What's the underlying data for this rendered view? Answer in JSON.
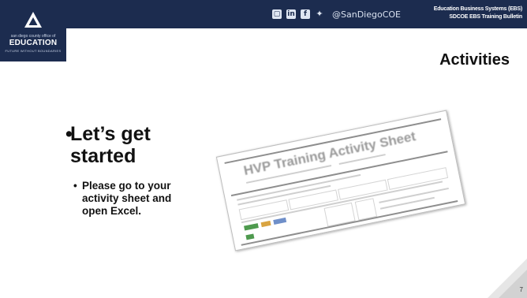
{
  "header": {
    "social_handle": "@SanDiegoCOE",
    "social_icons": [
      "ipad-icon",
      "linkedin-icon",
      "facebook-icon",
      "twitter-icon"
    ],
    "department_lines": [
      "Education Business Systems (EBS)",
      "SDCOE EBS Training Bulletin"
    ],
    "bar_color": "#1c2c4f"
  },
  "logo": {
    "small_text": "san diego county office of",
    "big_text": "EDUCATION",
    "tagline": "FUTURE WITHOUT BOUNDARIES"
  },
  "slide": {
    "title": "Activities",
    "bullet_main": "Let’s get started",
    "bullet_sub": "Please go to your activity sheet and open Excel.",
    "page_number": "7"
  },
  "image": {
    "title": "HVP Training Activity Sheet"
  }
}
